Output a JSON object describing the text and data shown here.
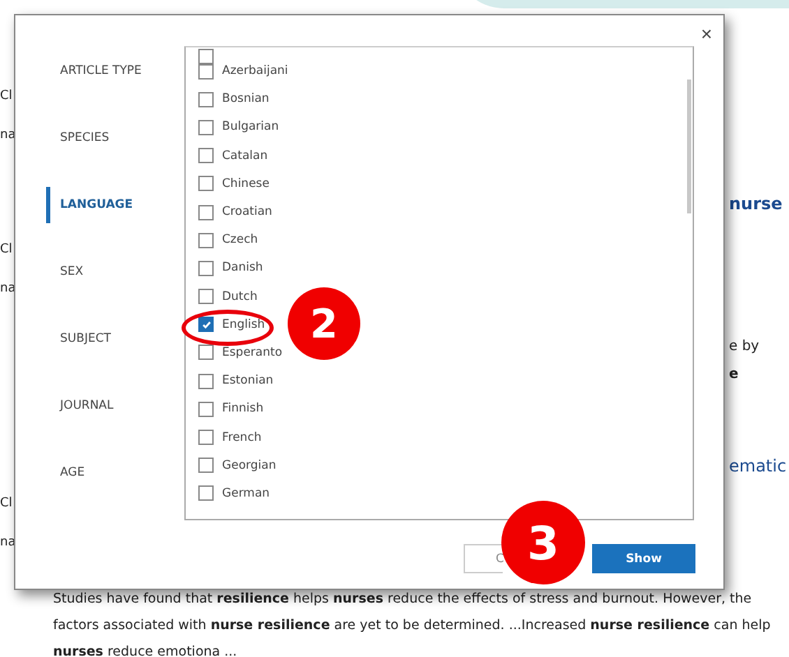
{
  "background": {
    "left_fragments": [
      "Cl",
      "na",
      "Cl",
      "na",
      "Cl",
      "na"
    ],
    "right_fragments": [
      {
        "kind": "link",
        "text": "nurse"
      },
      {
        "kind": "plain",
        "text": "e by"
      },
      {
        "kind": "bold",
        "text": "e"
      },
      {
        "kind": "link",
        "text": "ematic"
      }
    ],
    "snippet": [
      "Studies have found that **resilience** helps **nurses** reduce the effects of stress and burnout. However, the",
      "factors associated with **nurse resilience** are yet to be determined. ...Increased **nurse resilience** can help",
      "**nurses** reduce emotiona ..."
    ]
  },
  "dialog": {
    "close": "×",
    "sidebar": [
      {
        "label": "ARTICLE TYPE",
        "selected": false
      },
      {
        "label": "SPECIES",
        "selected": false
      },
      {
        "label": "LANGUAGE",
        "selected": true
      },
      {
        "label": "SEX",
        "selected": false
      },
      {
        "label": "SUBJECT",
        "selected": false
      },
      {
        "label": "JOURNAL",
        "selected": false
      },
      {
        "label": "AGE",
        "selected": false
      }
    ],
    "clipped_option": {
      "checked": false
    },
    "options": [
      {
        "label": "Azerbaijani",
        "checked": false
      },
      {
        "label": "Bosnian",
        "checked": false
      },
      {
        "label": "Bulgarian",
        "checked": false
      },
      {
        "label": "Catalan",
        "checked": false
      },
      {
        "label": "Chinese",
        "checked": false
      },
      {
        "label": "Croatian",
        "checked": false
      },
      {
        "label": "Czech",
        "checked": false
      },
      {
        "label": "Danish",
        "checked": false
      },
      {
        "label": "Dutch",
        "checked": false
      },
      {
        "label": "English",
        "checked": true
      },
      {
        "label": "Esperanto",
        "checked": false
      },
      {
        "label": "Estonian",
        "checked": false
      },
      {
        "label": "Finnish",
        "checked": false
      },
      {
        "label": "French",
        "checked": false
      },
      {
        "label": "Georgian",
        "checked": false
      },
      {
        "label": "German",
        "checked": false
      }
    ],
    "buttons": [
      {
        "kind": "secondary",
        "label": "C"
      },
      {
        "kind": "primary",
        "label": "Show"
      }
    ]
  },
  "annotations": [
    {
      "kind": "ellipse"
    },
    {
      "kind": "badge",
      "text": "2"
    },
    {
      "kind": "badge",
      "text": "3"
    }
  ]
}
